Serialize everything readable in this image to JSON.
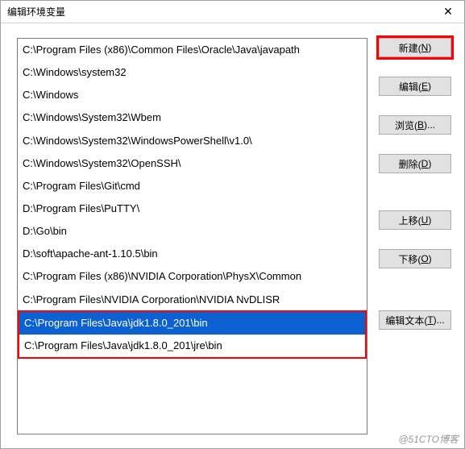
{
  "window": {
    "title": "编辑环境变量",
    "close_glyph": "✕"
  },
  "list": {
    "items": [
      {
        "text": "C:\\Program Files (x86)\\Common Files\\Oracle\\Java\\javapath",
        "selected": false
      },
      {
        "text": "C:\\Windows\\system32",
        "selected": false
      },
      {
        "text": "C:\\Windows",
        "selected": false
      },
      {
        "text": "C:\\Windows\\System32\\Wbem",
        "selected": false
      },
      {
        "text": "C:\\Windows\\System32\\WindowsPowerShell\\v1.0\\",
        "selected": false
      },
      {
        "text": "C:\\Windows\\System32\\OpenSSH\\",
        "selected": false
      },
      {
        "text": "C:\\Program Files\\Git\\cmd",
        "selected": false
      },
      {
        "text": "D:\\Program Files\\PuTTY\\",
        "selected": false
      },
      {
        "text": "D:\\Go\\bin",
        "selected": false
      },
      {
        "text": "D:\\soft\\apache-ant-1.10.5\\bin",
        "selected": false
      },
      {
        "text": "C:\\Program Files (x86)\\NVIDIA Corporation\\PhysX\\Common",
        "selected": false
      },
      {
        "text": "C:\\Program Files\\NVIDIA Corporation\\NVIDIA NvDLISR",
        "selected": false
      },
      {
        "text": "C:\\Program Files\\Java\\jdk1.8.0_201\\bin",
        "selected": true
      },
      {
        "text": "C:\\Program Files\\Java\\jdk1.8.0_201\\jre\\bin",
        "selected": false
      }
    ],
    "highlight_group_start": 12,
    "highlight_group_end": 13
  },
  "buttons": {
    "new": {
      "label": "新建(",
      "hotkey": "N",
      "tail": ")"
    },
    "edit": {
      "label": "编辑(",
      "hotkey": "E",
      "tail": ")"
    },
    "browse": {
      "label": "浏览(",
      "hotkey": "B",
      "tail": ")..."
    },
    "delete": {
      "label": "删除(",
      "hotkey": "D",
      "tail": ")"
    },
    "move_up": {
      "label": "上移(",
      "hotkey": "U",
      "tail": ")"
    },
    "move_down": {
      "label": "下移(",
      "hotkey": "O",
      "tail": ")"
    },
    "edit_text": {
      "label": "编辑文本(",
      "hotkey": "T",
      "tail": ")..."
    }
  },
  "watermark": "@51CTO博客"
}
